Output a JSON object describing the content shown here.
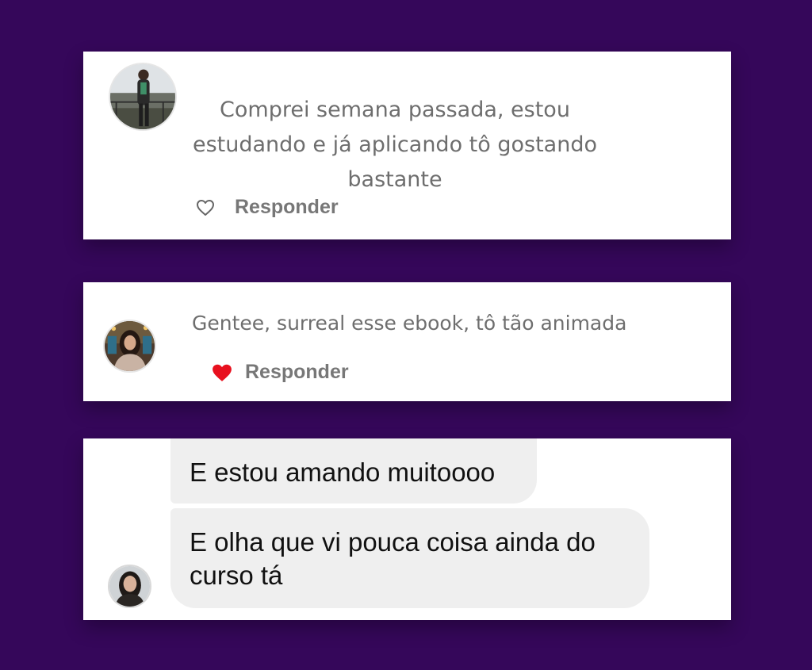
{
  "comments": [
    {
      "text": "Comprei semana passada, estou estudando e já aplicando tô gostando bastante",
      "reply_label": "Responder",
      "liked": false,
      "heart_icon": "heart-outline-icon"
    },
    {
      "text": "Gentee, surreal esse ebook, tô tão animada",
      "reply_label": "Responder",
      "liked": true,
      "heart_icon": "heart-filled-icon"
    }
  ],
  "chat": {
    "messages": [
      "E estou amando muitoooo",
      "E olha que vi pouca coisa ainda do curso tá"
    ]
  },
  "colors": {
    "background": "#35075a",
    "heart_liked": "#e8101e",
    "bubble": "#efefef"
  }
}
